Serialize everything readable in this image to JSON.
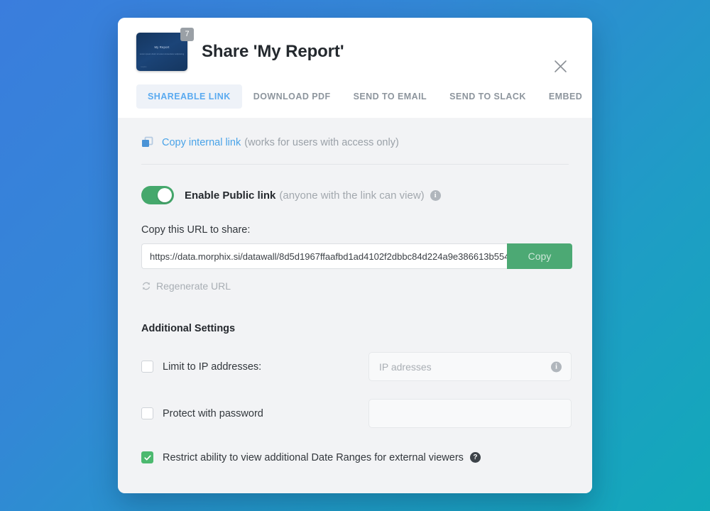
{
  "theme": {
    "bg_gradient_from": "#3a7ddd",
    "bg_gradient_to": "#12a9b9",
    "accent_blue": "#49a3e8",
    "accent_green": "#4ca974",
    "toggle_on": "#45a86c"
  },
  "modal": {
    "title": "Share 'My Report'",
    "close_icon": "close-icon",
    "thumbnail": {
      "badge_count": "7",
      "title_text": "My Report",
      "subtitle_text": "Lorem ipsum dolor sit amet consectetur adipiscing",
      "footer_text": "morphix"
    },
    "tabs": [
      {
        "label": "SHAREABLE LINK",
        "active": true
      },
      {
        "label": "DOWNLOAD PDF",
        "active": false
      },
      {
        "label": "SEND TO EMAIL",
        "active": false
      },
      {
        "label": "SEND TO SLACK",
        "active": false
      },
      {
        "label": "EMBED",
        "active": false
      }
    ],
    "internal_link": {
      "icon": "copy-icon",
      "link_text": "Copy internal link",
      "note": "(works for users with access only)"
    },
    "public_link": {
      "toggle_state": "on",
      "label": "Enable Public link",
      "note": "(anyone with the link can view)",
      "info_icon": "info-icon",
      "info_glyph": "i"
    },
    "url_section": {
      "label": "Copy this URL to share:",
      "url_value": "https://data.morphix.si/datawall/8d5d1967ffaafbd1ad4102f2dbbc84d224a9e386613b554",
      "copy_button_label": "Copy",
      "regenerate_icon": "refresh-icon",
      "regenerate_label": "Regenerate URL"
    },
    "additional_settings": {
      "title": "Additional Settings",
      "rows": [
        {
          "checkbox_checked": false,
          "label": "Limit to IP addresses:",
          "field_placeholder": "IP adresses",
          "field_value": "",
          "has_field": true,
          "field_info_icon": "info-icon",
          "field_info_glyph": "i"
        },
        {
          "checkbox_checked": false,
          "label": "Protect with password",
          "field_placeholder": "",
          "field_value": "",
          "has_field": true,
          "field_info_icon": "",
          "field_info_glyph": ""
        }
      ],
      "final_option": {
        "checkbox_checked": true,
        "check_glyph": "✓",
        "label": "Restrict ability to view additional Date Ranges for external viewers",
        "help_icon": "help-icon",
        "help_glyph": "?"
      }
    }
  }
}
